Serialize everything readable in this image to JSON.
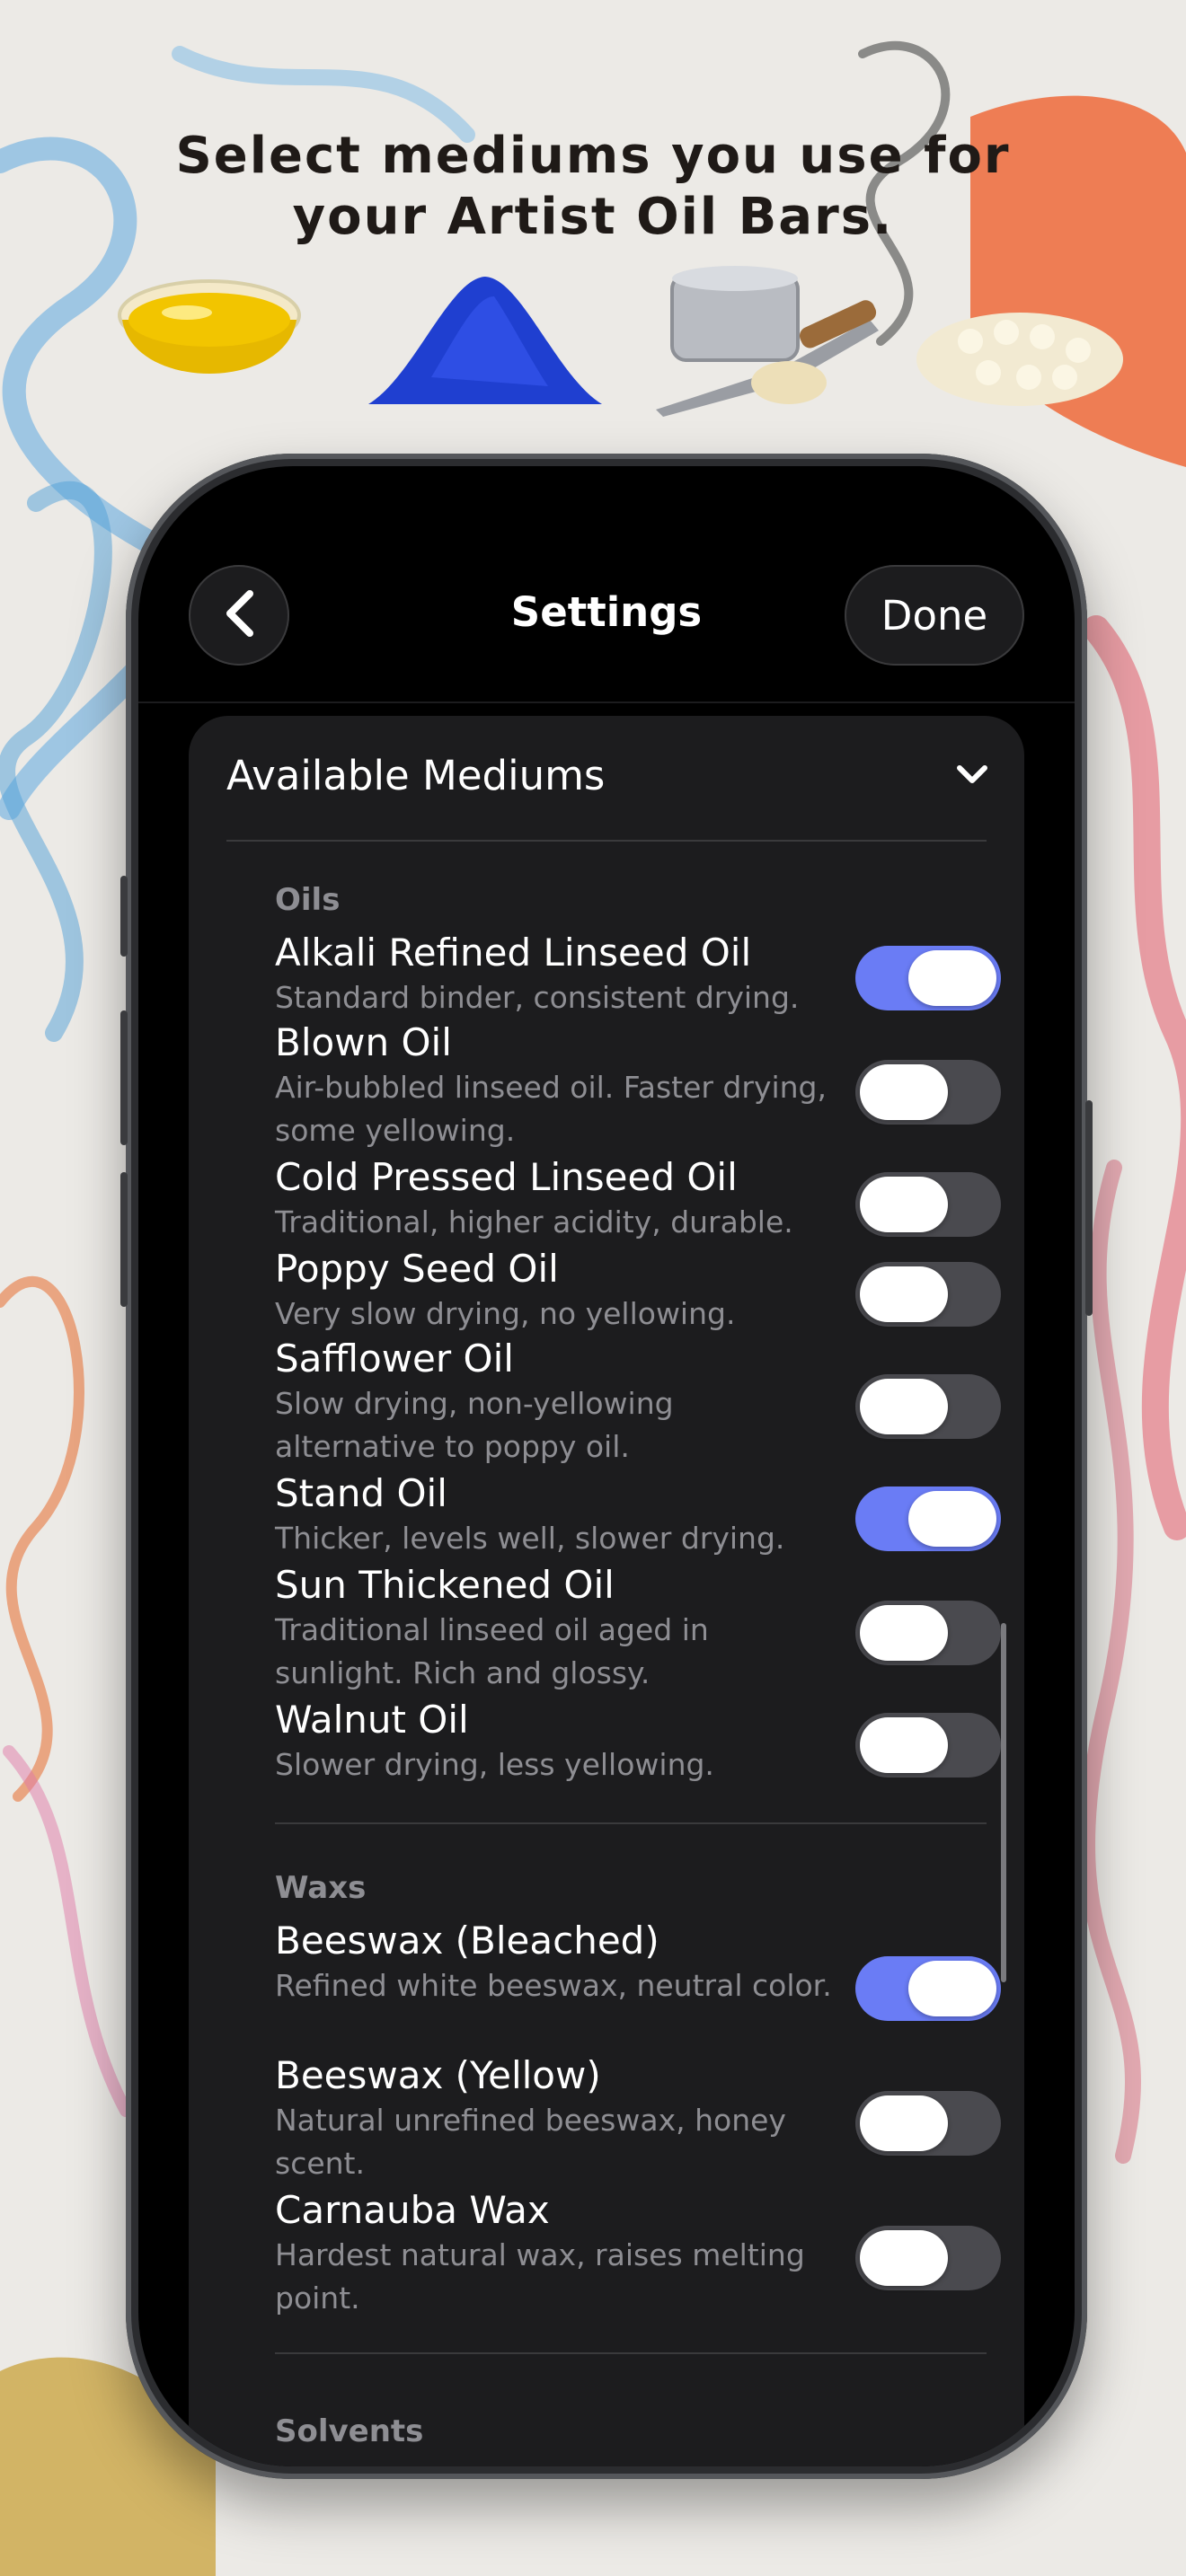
{
  "headline": {
    "line1": "Select mediums you use for",
    "line2": "your Artist Oil Bars."
  },
  "illustrations": [
    "oil-bowl",
    "blue-pigment",
    "wax-tin-with-knife",
    "wax-pellets"
  ],
  "nav": {
    "title": "Settings",
    "back_icon": "chevron-left-icon",
    "done_label": "Done"
  },
  "card": {
    "title": "Available Mediums",
    "expand_icon": "chevron-down-icon"
  },
  "sections": {
    "oils": {
      "label": "Oils",
      "items": [
        {
          "name": "Alkali Refined Linseed Oil",
          "desc": "Standard binder, consistent drying.",
          "enabled": true
        },
        {
          "name": "Blown Oil",
          "desc": "Air-bubbled linseed oil. Faster drying, some yellowing.",
          "enabled": false
        },
        {
          "name": "Cold Pressed Linseed Oil",
          "desc": "Traditional, higher acidity, durable.",
          "enabled": false
        },
        {
          "name": "Poppy Seed Oil",
          "desc": "Very slow drying, no yellowing.",
          "enabled": false
        },
        {
          "name": "Safflower Oil",
          "desc": "Slow drying, non-yellowing alternative to poppy oil.",
          "enabled": false
        },
        {
          "name": "Stand Oil",
          "desc": "Thicker, levels well, slower drying.",
          "enabled": true
        },
        {
          "name": "Sun Thickened Oil",
          "desc": "Traditional linseed oil aged in sunlight. Rich and glossy.",
          "enabled": false
        },
        {
          "name": "Walnut Oil",
          "desc": "Slower drying, less yellowing.",
          "enabled": false
        }
      ]
    },
    "waxes": {
      "label": "Waxs",
      "items": [
        {
          "name": "Beeswax (Bleached)",
          "desc": "Refined white beeswax, neutral color.",
          "enabled": true
        },
        {
          "name": "Beeswax (Yellow)",
          "desc": "Natural unrefined beeswax, honey scent.",
          "enabled": false
        },
        {
          "name": "Carnauba Wax",
          "desc": "Hardest natural wax, raises melting point.",
          "enabled": false
        }
      ]
    },
    "next": {
      "label": "Solvents"
    }
  },
  "colors": {
    "accent": "#6a7cf5",
    "toggle_off": "#4a4a4f",
    "card_bg": "#1c1c1e",
    "screen_bg": "#000000"
  }
}
